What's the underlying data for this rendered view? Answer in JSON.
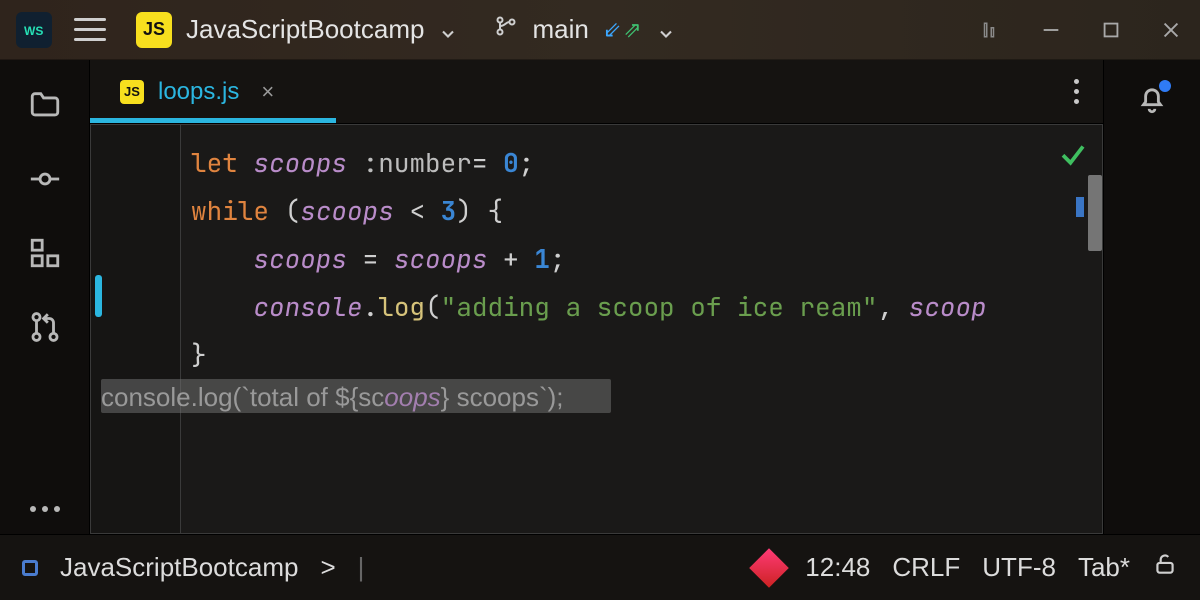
{
  "titlebar": {
    "project_name": "JavaScriptBootcamp",
    "branch": "main",
    "js_badge": "JS"
  },
  "tab": {
    "filename": "loops.js",
    "js_badge": "JS",
    "close": "×"
  },
  "code": {
    "l1_let": "let",
    "l1_id": "scoops",
    "l1_ann": ":number",
    "l1_eq": "=",
    "l1_val": "0",
    "l1_semi": ";",
    "l2_while": "while",
    "l2_lp": "(",
    "l2_id": "scoops",
    "l2_lt": " < ",
    "l2_num": "3",
    "l2_rp": ")",
    "l2_brace": " {",
    "l3_id": "scoops",
    "l3_eq": " = ",
    "l3_id2": "scoops",
    "l3_plus": " + ",
    "l3_num": "1",
    "l3_semi": ";",
    "l4_console": "console",
    "l4_dot": ".",
    "l4_log": "log",
    "l4_lp": "(",
    "l4_str": "\"adding a scoop of ice ream\"",
    "l4_comma": ", ",
    "l4_id": "scoop",
    "l5_brace": "}",
    "l6_pre": "console.log(`total of ${sc",
    "l6_mid": "oops",
    "l6_post": "} scoops`);"
  },
  "status": {
    "breadcrumb": "JavaScriptBootcamp",
    "breadcrumb_sep": ">",
    "cursor": "12:48",
    "eol": "CRLF",
    "encoding": "UTF-8",
    "indent": "Tab*"
  },
  "icons": {
    "hamburger": "menu-icon",
    "app": "webstorm-icon",
    "chevdown": "chevron-down-icon",
    "branch": "branch-icon",
    "update": "update-project-icon",
    "minimize": "minimize-icon",
    "maximize": "maximize-icon",
    "close": "close-icon",
    "folder": "folder-icon",
    "commit": "commit-icon",
    "structure": "structure-icon",
    "pr": "pull-request-icon",
    "more": "more-icon",
    "bell": "notifications-icon",
    "lock": "lock-open-icon",
    "actions": "more-actions-icon",
    "check": "problems-ok-icon",
    "build": "build-icon",
    "account": "account-icon"
  }
}
